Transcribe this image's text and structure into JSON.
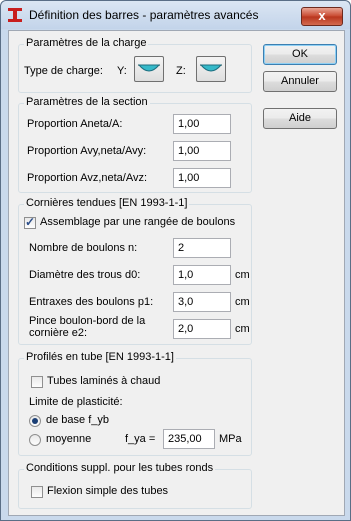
{
  "window": {
    "title": "Définition des barres - paramètres avancés",
    "close_label": "x"
  },
  "buttons": {
    "ok": "OK",
    "cancel": "Annuler",
    "help": "Aide"
  },
  "charge": {
    "group_title": "Paramètres de la charge",
    "type_label": "Type de charge:",
    "y_label": "Y:",
    "z_label": "Z:"
  },
  "section": {
    "group_title": "Paramètres de la section",
    "rows": [
      {
        "label": "Proportion  Aneta/A:",
        "value": "1,00"
      },
      {
        "label": "Proportion  Avy,neta/Avy:",
        "value": "1,00"
      },
      {
        "label": "Proportion  Avz,neta/Avz:",
        "value": "1,00"
      }
    ]
  },
  "corniere": {
    "group_title": "Cornières tendues [EN 1993-1-1]",
    "checkbox_label": "Assemblage par une rangée de boulons",
    "checkbox_checked": true,
    "bolts_label": "Nombre de boulons n:",
    "bolts_value": "2",
    "diameter_label": "Diamètre des trous d0:",
    "diameter_value": "1,0",
    "diameter_unit": "cm",
    "spacing_label": "Entraxes des boulons p1:",
    "spacing_value": "3,0",
    "spacing_unit": "cm",
    "pince_label_line1": "Pince boulon-bord de la",
    "pince_label_line2": "cornière e2:",
    "pince_value": "2,0",
    "pince_unit": "cm"
  },
  "tube": {
    "group_title": "Profilés en tube [EN 1993-1-1]",
    "hot_rolled_label": "Tubes laminés à chaud",
    "hot_rolled_checked": false,
    "plasticity_label": "Limite de plasticité:",
    "radio_base_label": "de base f_yb",
    "radio_mean_label": "moyenne",
    "fya_label": "f_ya =",
    "fya_value": "235,00",
    "fya_unit": "MPa"
  },
  "round_tubes": {
    "group_title": "Conditions suppl. pour les tubes ronds",
    "bending_label": "Flexion simple des tubes",
    "bending_checked": false
  },
  "icons": {
    "app": "steel-beam-icon",
    "load_y": "load-shape-icon",
    "load_z": "load-shape-icon"
  }
}
